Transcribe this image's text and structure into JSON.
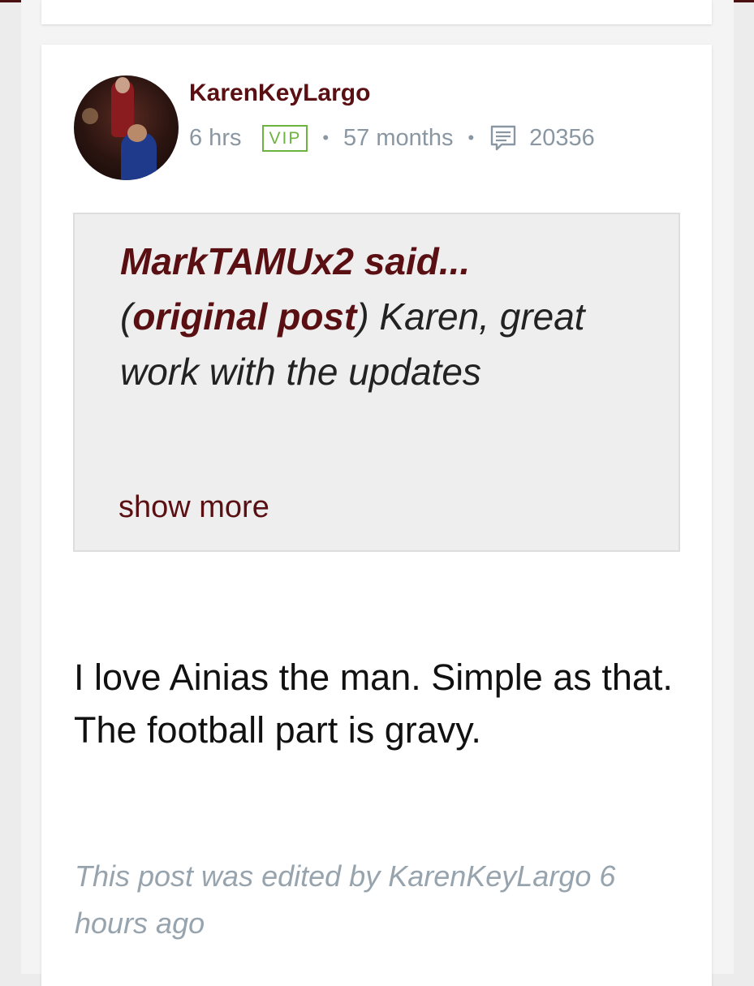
{
  "post": {
    "username": "KarenKeyLargo",
    "time": "6 hrs",
    "badge": "VIP",
    "tenure": "57 months",
    "post_count": "20356",
    "separator": "•",
    "quote": {
      "author_line": "MarkTAMUx2 said...",
      "open_paren": "(",
      "link_label": "original post",
      "text": ") Karen, great work with the updates",
      "show_more": "show more"
    },
    "body": "I love Ainias the man. Simple as that. The football part is gravy.",
    "edit_note": "This post was edited by KarenKeyLargo 6 hours ago"
  },
  "colors": {
    "brand": "#5a0f12",
    "vip": "#6db33f",
    "meta": "#8a97a2",
    "quote_bg": "#eeeeee"
  },
  "icons": {
    "comment": "comment-lines-icon",
    "avatar": "user-avatar"
  }
}
